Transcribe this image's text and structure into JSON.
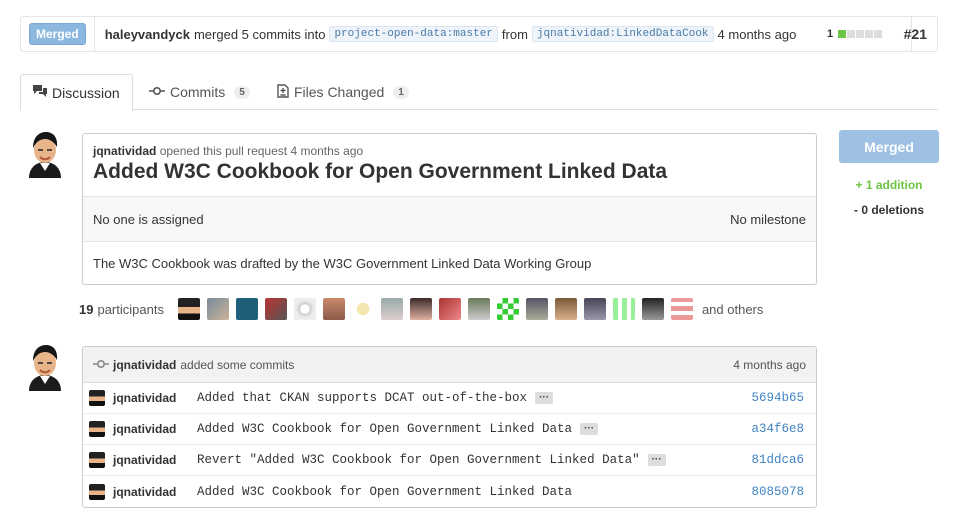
{
  "topbar": {
    "status_label": "Merged",
    "merger": "haleyvandyck",
    "action_text": "merged 5 commits into",
    "base_branch": "project-open-data:master",
    "from_text": "from",
    "head_branch": "jqnatividad:LinkedDataCook",
    "time": "4 months ago",
    "diffstat_count": "1",
    "pr_number": "#21"
  },
  "tabs": [
    {
      "label": "Discussion",
      "count": ""
    },
    {
      "label": "Commits",
      "count": "5"
    },
    {
      "label": "Files Changed",
      "count": "1"
    }
  ],
  "discussion": {
    "author": "jqnatividad",
    "opened_text": "opened this pull request 4 months ago",
    "title": "Added W3C Cookbook for Open Government Linked Data",
    "assignee_text": "No one is assigned",
    "milestone_text": "No milestone",
    "body": "The W3C Cookbook was drafted by the W3C Government Linked Data Working Group"
  },
  "sidebar": {
    "merged_button": "Merged",
    "additions": "+ 1 addition",
    "deletions": "- 0 deletions"
  },
  "participants": {
    "count": "19",
    "label": "participants",
    "others": "and others"
  },
  "commits_section": {
    "author": "jqnatividad",
    "action": "added some commits",
    "time": "4 months ago",
    "rows": [
      {
        "author": "jqnatividad",
        "message": "Added that CKAN supports DCAT out-of-the-box",
        "has_ellipsis": true,
        "sha": "5694b65"
      },
      {
        "author": "jqnatividad",
        "message": "Added W3C Cookbook for Open Government Linked Data",
        "has_ellipsis": true,
        "sha": "a34f6e8"
      },
      {
        "author": "jqnatividad",
        "message": "Revert \"Added W3C Cookbook for Open Government Linked Data\"",
        "has_ellipsis": true,
        "sha": "81ddca6"
      },
      {
        "author": "jqnatividad",
        "message": "Added W3C Cookbook for Open Government Linked Data",
        "has_ellipsis": false,
        "sha": "8085078"
      }
    ]
  }
}
